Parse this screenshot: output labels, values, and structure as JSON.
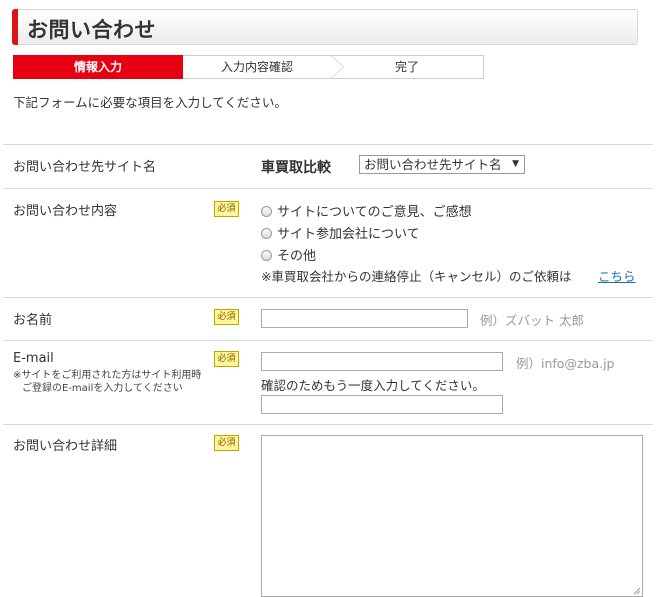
{
  "header": {
    "title": "お問い合わせ"
  },
  "steps": [
    "情報入力",
    "入力内容確認",
    "完了"
  ],
  "intro": "下記フォームに必要な項目を入力してください。",
  "required_label": "必須",
  "fields": {
    "site": {
      "label": "お問い合わせ先サイト名",
      "site_name": "車買取比較",
      "select_value": "お問い合わせ先サイト名"
    },
    "inquiry_type": {
      "label": "お問い合わせ内容",
      "options": [
        "サイトについてのご意見、ご感想",
        "サイト参加会社について",
        "その他"
      ],
      "note": "※車買取会社からの連絡停止（キャンセル）のご依頼は",
      "link": "こちら"
    },
    "name": {
      "label": "お名前",
      "example": "例）ズバット 太郎"
    },
    "email": {
      "label": "E-mail",
      "sublabel_1": "※サイトをご利用された方はサイト利用時",
      "sublabel_2": "ご登録のE-mailを入力してください",
      "example": "例）info@zba.jp",
      "confirm": "確認のためもう一度入力してください。"
    },
    "detail": {
      "label": "お問い合わせ詳細"
    }
  },
  "colors": {
    "accent": "#e60012",
    "required_bg": "#fff59a",
    "link": "#1a6fb5"
  }
}
